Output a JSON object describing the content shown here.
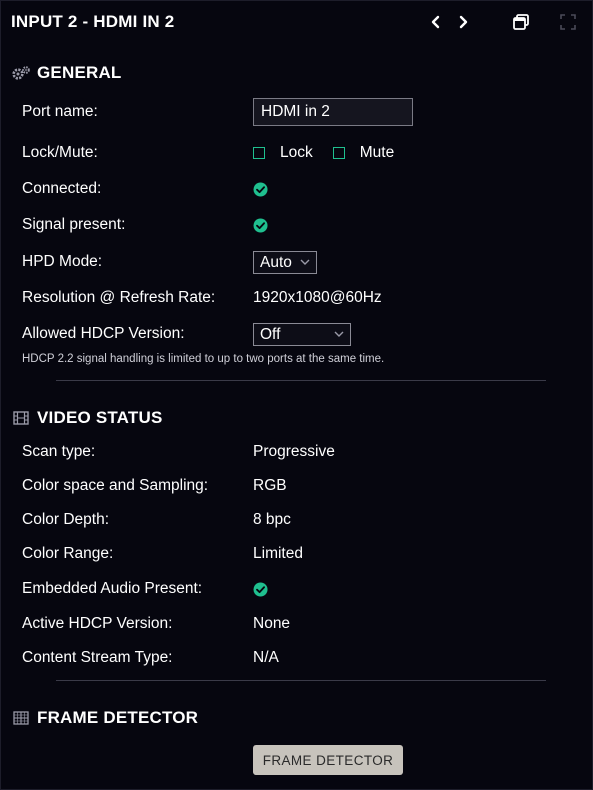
{
  "title": "INPUT 2 - HDMI IN 2",
  "colors": {
    "accent": "#1fbf8f",
    "background": "#06060f"
  },
  "general": {
    "heading": "GENERAL",
    "port_name_label": "Port name:",
    "port_name_value": "HDMI in 2",
    "lock_mute_label": "Lock/Mute:",
    "lock_label": "Lock",
    "mute_label": "Mute",
    "connected_label": "Connected:",
    "signal_present_label": "Signal present:",
    "hpd_mode_label": "HPD Mode:",
    "hpd_mode_value": "Auto",
    "resolution_label": "Resolution @ Refresh Rate:",
    "resolution_value": "1920x1080@60Hz",
    "hdcp_allowed_label": "Allowed HDCP Version:",
    "hdcp_allowed_value": "Off",
    "hdcp_note": "HDCP 2.2 signal handling is limited to up to two ports at the same time."
  },
  "video_status": {
    "heading": "VIDEO STATUS",
    "scan_type_label": "Scan type:",
    "scan_type_value": "Progressive",
    "color_space_label": "Color space and Sampling:",
    "color_space_value": "RGB",
    "color_depth_label": "Color Depth:",
    "color_depth_value": "8 bpc",
    "color_range_label": "Color Range:",
    "color_range_value": "Limited",
    "embedded_audio_label": "Embedded Audio Present:",
    "active_hdcp_label": "Active HDCP Version:",
    "active_hdcp_value": "None",
    "content_stream_label": "Content Stream Type:",
    "content_stream_value": "N/A"
  },
  "frame_detector": {
    "heading": "FRAME DETECTOR",
    "button_label": "FRAME DETECTOR"
  }
}
